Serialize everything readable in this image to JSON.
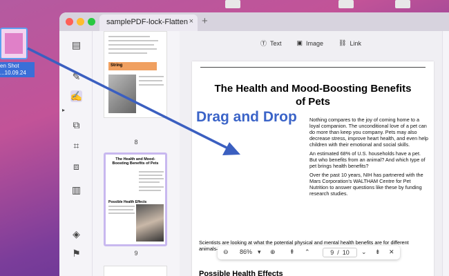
{
  "desktop": {
    "file_label_line1": "en Shot",
    "file_label_line2": "...10.09.24"
  },
  "tab": {
    "title": "samplePDF-lock-Flatten",
    "close": "×",
    "add": "+"
  },
  "toolbar": {
    "text_label": "Text",
    "image_label": "Image",
    "link_label": "Link"
  },
  "thumbnails": [
    {
      "page_number": "8",
      "heading": "String"
    },
    {
      "page_number": "9",
      "title": "The Health and Mood-Boosting Benefits of Pets",
      "subheading": "Possible Health Effects"
    }
  ],
  "document": {
    "title": "The Health and Mood-Boosting Benefits of Pets",
    "para1": "Nothing compares to the joy of coming home to a loyal companion. The unconditional love of a pet can do more than keep you company. Pets may also decrease stress, improve heart health, and even help children with their emotional and social skills.",
    "para2": "An estimated 68% of U.S. households have a pet. But who benefits from an animal? And which type of pet brings health benefits?",
    "para3": "Over the past 10 years, NIH has partnered with the Mars Corporation's WALTHAM Centre for Pet Nutrition to answer questions like these by funding research studies.",
    "para_full": "Scientists are looking at what the potential physical and mental health benefits are for different animals—from fish to guinea pigs to dogs and cats.",
    "section_heading": "Possible Health Effects"
  },
  "overlay": {
    "drag_text": "Drag and Drop"
  },
  "zoom": {
    "level": "86%",
    "current_page": "9",
    "separator": "/",
    "total_pages": "10"
  }
}
